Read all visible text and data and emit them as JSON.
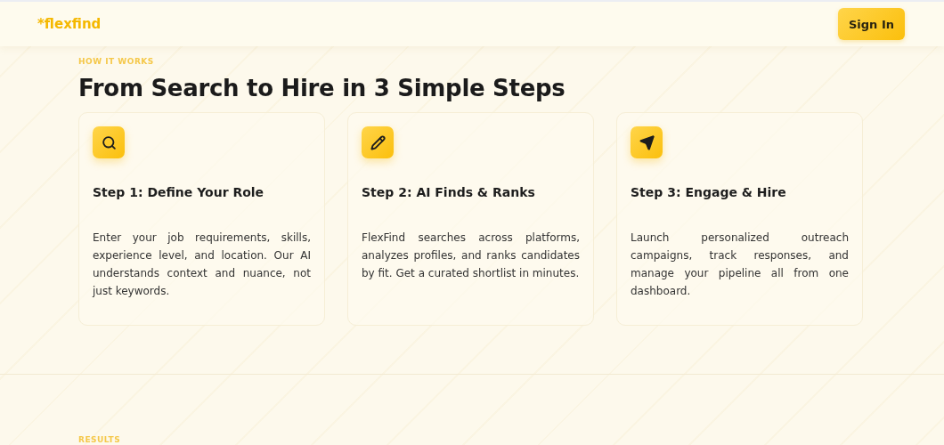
{
  "header": {
    "logo": {
      "mark": "*",
      "name": "flexfind"
    },
    "sign_in": "Sign In"
  },
  "how_it_works": {
    "eyebrow": "HOW IT WORKS",
    "title": "From Search to Hire in 3 Simple Steps",
    "steps": [
      {
        "title": "Step 1: Define Your Role",
        "description": "Enter your job requirements, skills, experience level, and location. Our AI understands context and nuance, not just keywords."
      },
      {
        "title": "Step 2: AI Finds & Ranks",
        "description": "FlexFind searches across platforms, analyzes profiles, and ranks candidates by fit. Get a curated shortlist in minutes."
      },
      {
        "title": "Step 3: Engage & Hire",
        "description": "Launch personalized outreach campaigns, track responses, and manage your pipeline all from one dashboard."
      }
    ]
  },
  "results": {
    "eyebrow": "RESULTS"
  }
}
